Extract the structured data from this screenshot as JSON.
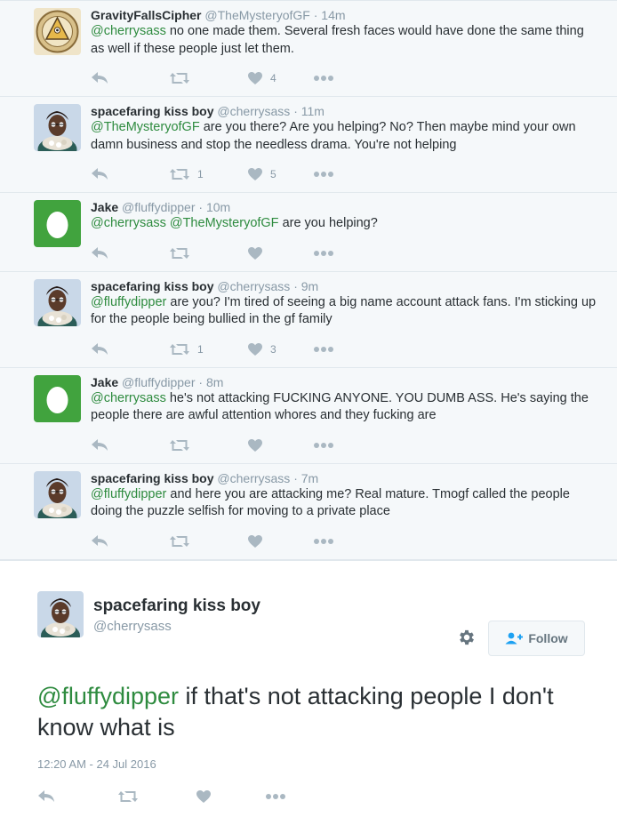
{
  "thread": [
    {
      "avatar": "triangle-cipher-avatar",
      "name": "GravityFallsCipher",
      "handle": "@TheMysteryofGF",
      "time": "14m",
      "parts": [
        {
          "text": "@cherrysass",
          "mention": true
        },
        {
          "text": " no one made them. Several fresh faces would have done the same thing as well if these people just let them.",
          "mention": false
        }
      ],
      "retweets": "",
      "likes": "4"
    },
    {
      "avatar": "spacefaring-avatar",
      "name": "spacefaring kiss boy",
      "handle": "@cherrysass",
      "time": "11m",
      "parts": [
        {
          "text": "@TheMysteryofGF",
          "mention": true
        },
        {
          "text": " are you there? Are you helping? No? Then maybe mind your own damn business and stop the needless drama. You're not helping",
          "mention": false
        }
      ],
      "retweets": "1",
      "likes": "5"
    },
    {
      "avatar": "egg-avatar",
      "name": "Jake",
      "handle": "@fluffydipper",
      "time": "10m",
      "parts": [
        {
          "text": "@cherrysass",
          "mention": true
        },
        {
          "text": " ",
          "mention": false
        },
        {
          "text": "@TheMysteryofGF",
          "mention": true
        },
        {
          "text": " are you helping?",
          "mention": false
        }
      ],
      "retweets": "",
      "likes": ""
    },
    {
      "avatar": "spacefaring-avatar",
      "name": "spacefaring kiss boy",
      "handle": "@cherrysass",
      "time": "9m",
      "parts": [
        {
          "text": "@fluffydipper",
          "mention": true
        },
        {
          "text": " are you? I'm tired of seeing a big name account attack fans. I'm sticking up for the people being bullied in the gf family",
          "mention": false
        }
      ],
      "retweets": "1",
      "likes": "3"
    },
    {
      "avatar": "egg-avatar",
      "name": "Jake",
      "handle": "@fluffydipper",
      "time": "8m",
      "parts": [
        {
          "text": "@cherrysass",
          "mention": true
        },
        {
          "text": " he's not attacking FUCKING ANYONE. YOU DUMB ASS. He's saying the people there are awful attention whores and they fucking are",
          "mention": false
        }
      ],
      "retweets": "",
      "likes": ""
    },
    {
      "avatar": "spacefaring-avatar",
      "name": "spacefaring kiss boy",
      "handle": "@cherrysass",
      "time": "7m",
      "parts": [
        {
          "text": "@fluffydipper",
          "mention": true
        },
        {
          "text": " and here you are attacking me? Real mature. Tmogf called the people doing the puzzle selfish for moving to a private place",
          "mention": false
        }
      ],
      "retweets": "",
      "likes": ""
    }
  ],
  "main_tweet": {
    "name": "spacefaring kiss boy",
    "handle": "@cherrysass",
    "follow_label": "Follow",
    "mention": "@fluffydipper",
    "text": " if that's not attacking people I don't know what is",
    "timestamp": "12:20 AM - 24 Jul 2016"
  },
  "separator": "·",
  "colors": {
    "mention": "#2e8b3f",
    "muted": "#8899a6",
    "icon": "#aab8c2",
    "thread_bg": "#f5f8fa"
  }
}
